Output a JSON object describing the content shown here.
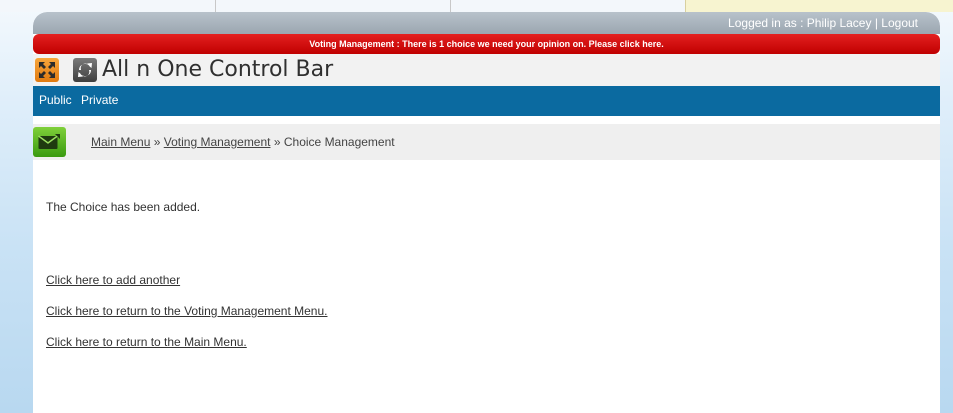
{
  "login": {
    "label": "Logged in as : Philip Lacey",
    "separator": "|",
    "logout": "Logout"
  },
  "alert": {
    "text": "Voting Management : There is 1 choice we need your opinion on.  Please click here."
  },
  "app": {
    "title": "All n One Control Bar"
  },
  "nav": {
    "items": [
      "Public",
      "Private"
    ]
  },
  "breadcrumb": {
    "items": [
      "Main Menu",
      "Voting Management",
      "Choice Management"
    ],
    "separator": "»"
  },
  "main": {
    "message": "The Choice has been added.",
    "links": [
      "Click here to add another",
      "Click here to return to the Voting Management Menu.",
      "Click here to return to the Main Menu."
    ]
  },
  "colors": {
    "alert": "#d00000",
    "nav": "#0b6aa0",
    "login_bar": "#a8b2bb"
  }
}
